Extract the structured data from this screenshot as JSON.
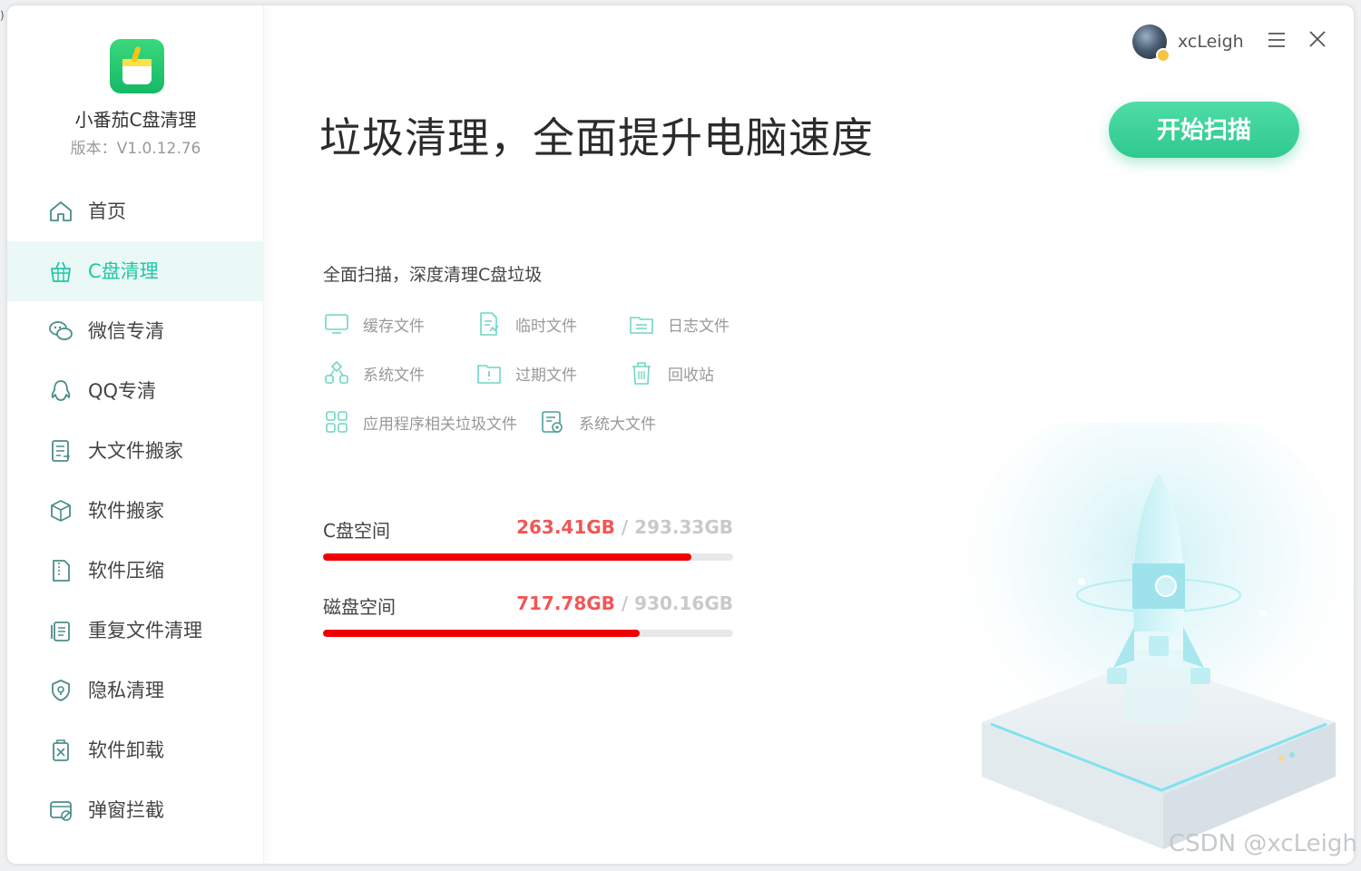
{
  "app": {
    "name": "小番茄C盘清理",
    "version": "版本：V1.0.12.76",
    "brand_color": "#2fc98e",
    "accent_color": "#1fc7a5",
    "icon": "broom-bin-logo"
  },
  "sidebar": {
    "items": [
      {
        "label": "首页",
        "icon": "home-icon",
        "active": false
      },
      {
        "label": "C盘清理",
        "icon": "basket-clean-icon",
        "active": true
      },
      {
        "label": "微信专清",
        "icon": "wechat-icon",
        "active": false
      },
      {
        "label": "QQ专清",
        "icon": "qq-icon",
        "active": false
      },
      {
        "label": "大文件搬家",
        "icon": "file-move-icon",
        "active": false
      },
      {
        "label": "软件搬家",
        "icon": "package-icon",
        "active": false
      },
      {
        "label": "软件压缩",
        "icon": "zip-file-icon",
        "active": false
      },
      {
        "label": "重复文件清理",
        "icon": "duplicate-file-icon",
        "active": false
      },
      {
        "label": "隐私清理",
        "icon": "shield-icon",
        "active": false
      },
      {
        "label": "软件卸载",
        "icon": "uninstall-icon",
        "active": false
      },
      {
        "label": "弹窗拦截",
        "icon": "popup-block-icon",
        "active": false
      }
    ]
  },
  "header": {
    "username": "xcLeigh",
    "avatar_icon": "user-avatar",
    "menu_icon": "hamburger-menu-icon",
    "close_icon": "close-icon"
  },
  "main": {
    "headline": "垃圾清理，全面提升电脑速度",
    "scan_button": "开始扫描",
    "subtitle": "全面扫描，深度清理C盘垃圾",
    "categories": [
      {
        "label": "缓存文件",
        "icon": "monitor-icon"
      },
      {
        "label": "临时文件",
        "icon": "doc-edit-icon"
      },
      {
        "label": "日志文件",
        "icon": "folder-icon"
      },
      {
        "label": "系统文件",
        "icon": "hierarchy-icon"
      },
      {
        "label": "过期文件",
        "icon": "expired-folder-icon"
      },
      {
        "label": "回收站",
        "icon": "trash-icon"
      },
      {
        "label": "应用程序相关垃圾文件",
        "icon": "apps-grid-icon"
      },
      {
        "label": "系统大文件",
        "icon": "system-file-icon"
      }
    ],
    "disks": [
      {
        "name": "C盘空间",
        "used": "263.41GB",
        "separator": " / ",
        "total": "293.33GB",
        "used_fraction": 0.898
      },
      {
        "name": "磁盘空间",
        "used": "717.78GB",
        "separator": " / ",
        "total": "930.16GB",
        "used_fraction": 0.772
      }
    ],
    "illustration": "rocket-illustration"
  },
  "watermark": "CSDN @xcLeigh",
  "edge_glyph": ")"
}
